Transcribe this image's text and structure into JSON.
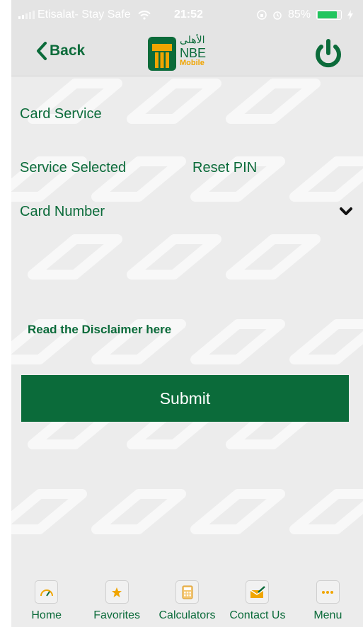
{
  "status_bar": {
    "carrier": "Etisalat- Stay Safe",
    "time": "21:52",
    "battery": "85%",
    "battery_level": 0.85
  },
  "nav": {
    "back_label": "Back",
    "logo": {
      "arabic": "الأهلى",
      "nbe": "NBE",
      "mobile": "Mobile"
    },
    "power_icon": "power-icon"
  },
  "form": {
    "section_title": "Card Service",
    "service_selected_label": "Service Selected",
    "service_selected_value": "Reset PIN",
    "card_number_label": "Card Number",
    "dropdown_icon": "chevron-down-icon",
    "disclaimer_link": "Read the Disclaimer here",
    "submit_label": "Submit"
  },
  "tab_bar": [
    {
      "label": "Home",
      "icon": "speedometer-icon"
    },
    {
      "label": "Favorites",
      "icon": "star-icon"
    },
    {
      "label": "Calculators",
      "icon": "calculator-icon"
    },
    {
      "label": "Contact Us",
      "icon": "envelope-pencil-icon"
    },
    {
      "label": "Menu",
      "icon": "more-dots-icon"
    }
  ],
  "colors": {
    "brand_green": "#0b6b3a",
    "accent_orange": "#f0a500",
    "background": "#ececec"
  }
}
